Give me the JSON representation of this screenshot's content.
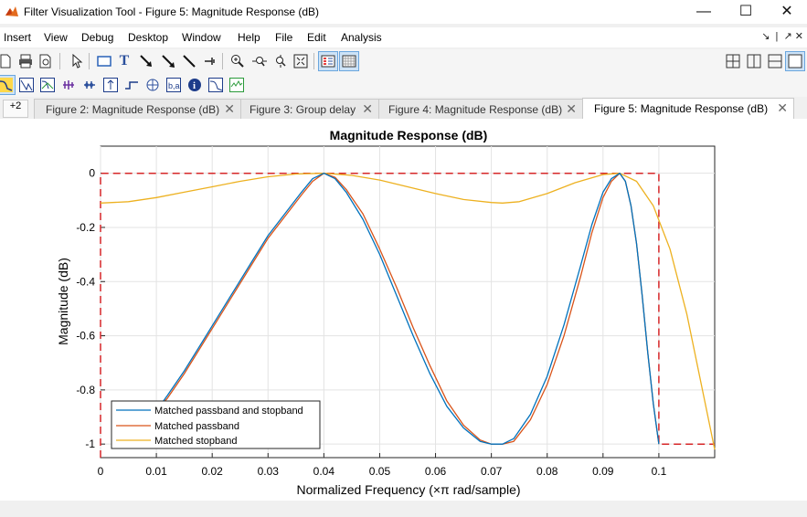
{
  "window": {
    "title": "Filter Visualization Tool - Figure 5: Magnitude Response (dB)"
  },
  "menu": [
    "Insert",
    "View",
    "Debug",
    "Desktop",
    "Window",
    "Help",
    "File",
    "Edit",
    "Analysis"
  ],
  "tabs": {
    "overflow_label": "+2",
    "items": [
      {
        "label": "Figure 2: Magnitude Response (dB)",
        "active": false
      },
      {
        "label": "Figure 3: Group delay",
        "active": false
      },
      {
        "label": "Figure 4: Magnitude Response (dB)",
        "active": false
      },
      {
        "label": "Figure 5: Magnitude Response (dB)",
        "active": true
      }
    ]
  },
  "colors": {
    "accent": "#0072bd",
    "series1": "#0072bd",
    "series2": "#d95319",
    "series3": "#edb120",
    "mask": "#d62728"
  },
  "chart_data": {
    "type": "line",
    "title": "Magnitude Response (dB)",
    "xlabel": "Normalized Frequency (×π rad/sample)",
    "ylabel": "Magnitude (dB)",
    "xlim": [
      0,
      0.11
    ],
    "ylim": [
      -1.05,
      0.1
    ],
    "xticks": [
      0,
      0.01,
      0.02,
      0.03,
      0.04,
      0.05,
      0.06,
      0.07,
      0.08,
      0.09,
      0.1
    ],
    "xtick_labels": [
      "0",
      "0.01",
      "0.02",
      "0.03",
      "0.04",
      "0.05",
      "0.06",
      "0.07",
      "0.08",
      "0.09",
      "0.1"
    ],
    "yticks": [
      0,
      -0.2,
      -0.4,
      -0.6,
      -0.8,
      -1
    ],
    "ytick_labels": [
      "0",
      "-0.2",
      "-0.4",
      "-0.6",
      "-0.8",
      "-1"
    ],
    "grid": true,
    "legend_position": "bottom-left",
    "series": [
      {
        "name": "Matched passband and stopband",
        "color": "#0072bd",
        "x": [
          0.0099,
          0.012,
          0.015,
          0.018,
          0.021,
          0.024,
          0.027,
          0.03,
          0.033,
          0.036,
          0.038,
          0.04,
          0.042,
          0.044,
          0.047,
          0.05,
          0.053,
          0.056,
          0.059,
          0.062,
          0.065,
          0.068,
          0.07,
          0.072,
          0.074,
          0.077,
          0.08,
          0.083,
          0.086,
          0.088,
          0.09,
          0.0915,
          0.093,
          0.094,
          0.095,
          0.096,
          0.097,
          0.098,
          0.099,
          0.1
        ],
        "y": [
          -0.88,
          -0.82,
          -0.73,
          -0.63,
          -0.53,
          -0.43,
          -0.33,
          -0.23,
          -0.15,
          -0.07,
          -0.02,
          0,
          -0.02,
          -0.07,
          -0.17,
          -0.3,
          -0.45,
          -0.6,
          -0.74,
          -0.86,
          -0.94,
          -0.99,
          -1.0,
          -1.0,
          -0.98,
          -0.89,
          -0.75,
          -0.56,
          -0.34,
          -0.19,
          -0.07,
          -0.02,
          0,
          -0.03,
          -0.12,
          -0.26,
          -0.45,
          -0.66,
          -0.85,
          -1.0
        ]
      },
      {
        "name": "Matched passband",
        "color": "#d95319",
        "x": [
          0.0099,
          0.012,
          0.015,
          0.018,
          0.021,
          0.024,
          0.027,
          0.03,
          0.033,
          0.036,
          0.038,
          0.04,
          0.042,
          0.044,
          0.047,
          0.05,
          0.053,
          0.056,
          0.059,
          0.062,
          0.065,
          0.068,
          0.07,
          0.072,
          0.074,
          0.077,
          0.08,
          0.083,
          0.086,
          0.088,
          0.09,
          0.0915,
          0.093,
          0.094,
          0.095,
          0.096,
          0.097,
          0.098,
          0.099,
          0.1
        ],
        "y": [
          -0.88,
          -0.83,
          -0.74,
          -0.64,
          -0.54,
          -0.44,
          -0.34,
          -0.24,
          -0.16,
          -0.08,
          -0.03,
          0,
          -0.015,
          -0.06,
          -0.15,
          -0.28,
          -0.42,
          -0.57,
          -0.71,
          -0.84,
          -0.93,
          -0.985,
          -1.0,
          -1.0,
          -0.99,
          -0.91,
          -0.78,
          -0.6,
          -0.38,
          -0.22,
          -0.09,
          -0.03,
          0,
          -0.03,
          -0.12,
          -0.26,
          -0.45,
          -0.66,
          -0.85,
          -1.0
        ]
      },
      {
        "name": "Matched stopband",
        "color": "#edb120",
        "x": [
          0,
          0.005,
          0.01,
          0.015,
          0.02,
          0.025,
          0.03,
          0.035,
          0.04,
          0.045,
          0.05,
          0.055,
          0.06,
          0.065,
          0.07,
          0.072,
          0.075,
          0.08,
          0.085,
          0.09,
          0.093,
          0.096,
          0.099,
          0.102,
          0.105,
          0.108,
          0.11
        ],
        "y": [
          -0.11,
          -0.105,
          -0.09,
          -0.07,
          -0.05,
          -0.03,
          -0.013,
          -0.003,
          0,
          -0.008,
          -0.025,
          -0.05,
          -0.075,
          -0.097,
          -0.108,
          -0.11,
          -0.105,
          -0.075,
          -0.035,
          -0.005,
          0,
          -0.03,
          -0.12,
          -0.28,
          -0.52,
          -0.82,
          -1.02
        ]
      }
    ],
    "mask": {
      "color": "#d62728",
      "x": [
        0,
        0,
        0.1,
        0.1,
        0.11
      ],
      "y": [
        -1.05,
        0,
        0,
        -1.0,
        -1.0
      ]
    }
  }
}
